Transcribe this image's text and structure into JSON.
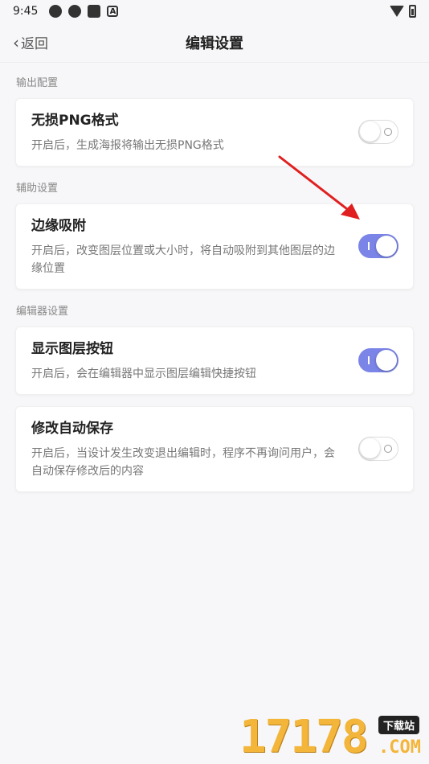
{
  "status": {
    "time": "9:45",
    "notif_a": "A"
  },
  "nav": {
    "back_label": "返回",
    "title": "编辑设置"
  },
  "sections": [
    {
      "label": "输出配置"
    },
    {
      "label": "辅助设置"
    },
    {
      "label": "编辑器设置"
    }
  ],
  "settings": [
    {
      "title": "无损PNG格式",
      "desc": "开启后，生成海报将输出无损PNG格式",
      "enabled": false
    },
    {
      "title": "边缘吸附",
      "desc": "开启后，改变图层位置或大小时，将自动吸附到其他图层的边缘位置",
      "enabled": true
    },
    {
      "title": "显示图层按钮",
      "desc": "开启后，会在编辑器中显示图层编辑快捷按钮",
      "enabled": true
    },
    {
      "title": "修改自动保存",
      "desc": "开启后，当设计发生改变退出编辑时，程序不再询问用户，会自动保存修改后的内容",
      "enabled": false
    }
  ],
  "colors": {
    "accent": "#7b85e8",
    "annotation_arrow": "#e02020"
  },
  "watermark": {
    "digits": "17178",
    "badge": "下载站",
    "suffix": ".COM"
  }
}
